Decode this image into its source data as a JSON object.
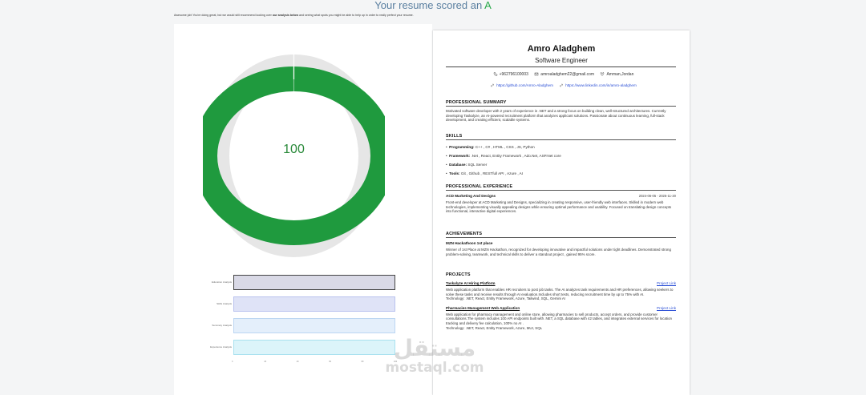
{
  "header": {
    "prefix": "Your resume scored an ",
    "grade": "A",
    "subline_part1": "Awesome job! You're doing great, but we would still recommend looking over ",
    "subline_bold": "our analysis below",
    "subline_part2": " and seeing what spots you might be able to help up in order to really perfect your resume."
  },
  "score": {
    "value_label": "100",
    "fraction": 1.0,
    "color": "#1f9a3e"
  },
  "bars": [
    {
      "label": "Education Analysis",
      "fraction": 1.0,
      "fill": "#d9d9e6",
      "border": "#444444"
    },
    {
      "label": "Skills Analysis",
      "fraction": 1.0,
      "fill": "#dfe3f7",
      "border": "#b9c2ee"
    },
    {
      "label": "Summary Analysis",
      "fraction": 1.0,
      "fill": "#e4effb",
      "border": "#bcd6f2"
    },
    {
      "label": "Experience Analysis",
      "fraction": 1.0,
      "fill": "#dcf4fa",
      "border": "#a9e1ef"
    }
  ],
  "axis_ticks": [
    "0",
    "20",
    "40",
    "60",
    "80",
    "100"
  ],
  "resume": {
    "name": "Amro Aladghem",
    "role": "Software Engineer",
    "phone": "+962796100003",
    "email": "amroaladghem22@gmail.com",
    "location": "Amman,Jordan",
    "github": "https://github.com/Amro-Aladghem",
    "linkedin": "https://www.linkedin.com/in/amro-aladghem",
    "summary": {
      "heading": "PROFESSIONAL SUMMARY",
      "text": "Motivated software developer with 2 years of experience in .NET and a strong focus on building clean, well-structured architectures. Currently developing Taskalyze, an AI-powered recruitment platform that analyzes applicant solutions. Passionate about continuous learning, full-stack development, and creating efficient, scalable systems."
    },
    "skills": {
      "heading": "SKILLS",
      "items": [
        {
          "name": "Programming:",
          "value": " C++ , C# , HTML , CSS , JS, Python"
        },
        {
          "name": "Framework:",
          "value": " .Net , React, Entity Framework , Ado.Net, ASP.Net core"
        },
        {
          "name": "Database:",
          "value": " SQL Server"
        },
        {
          "name": "Tools:",
          "value": " Git , Github , RESTfull API , Azure , AI"
        }
      ]
    },
    "experience": {
      "heading": "PROFESSIONAL EXPERIENCE",
      "company": "ACD Marketing And Designs",
      "date": "2024-06-05 - 2025-11-20",
      "text": "Front-end developer at ACD Marketing and Designs, specializing in creating responsive, user-friendly web interfaces. Skilled in modern web technologies, implementing visually appealing designs while ensuring optimal performance and usability. Focused on translating design concepts into functional, interactive digital experiences."
    },
    "achievements": {
      "heading": "ACHIEVEMENTS",
      "title": "MZN Hackathoon 1st place",
      "text": "Winner of 1st Place at MZN Hackathon, recognized for developing innovative and impactful solutions under tight deadlines. Demonstrated strong problem-solving, teamwork, and technical skills to deliver a standout project , gained 95% score."
    },
    "projects": {
      "heading": "PROJECTS",
      "link_label": "Project Link",
      "items": [
        {
          "title": "Taskalyze AI Hiring Platform",
          "text": "Web application platform that enables HR recruiters to post job tasks. The AI analyzes task requirements and HR preferences, allowing seekers to solve these tasks and receive results through AI evaluation.Includes short tests, reducing recruitment time by up to 75% with AI.",
          "tech": "Technology: .NET, React, Entity Framework, Azure, Tailwind, SQL, Gemini AI"
        },
        {
          "title": "Pharmacies Management Web Application",
          "text": "Web application for pharmacy management and online store, allowing pharmacies to sell products, accept orders, and provide customer consultations.The system includes 100 API endpoints built with .NET, a SQL database with 42 tables, and integrates external services for location tracking and delivery fee calculation, 100% no AI .",
          "tech": "Technology: .NET, React, Entity Framework, Azure, MUI, SQL"
        }
      ]
    }
  },
  "watermark": {
    "arabic": "مستقل",
    "latin": "mostaql.com"
  }
}
